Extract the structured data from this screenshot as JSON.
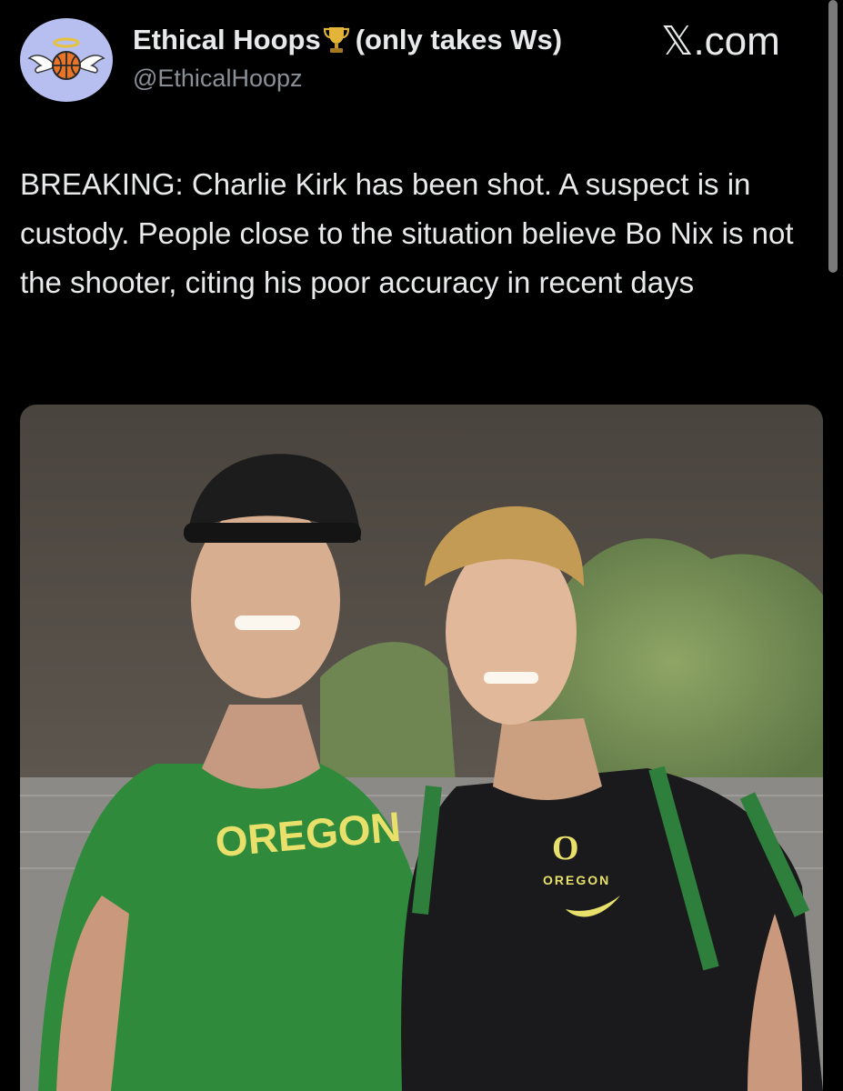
{
  "account": {
    "display_name": "Ethical Hoops",
    "display_suffix": "(only takes Ws)",
    "handle": "@EthicalHoopz",
    "avatar_icon": "angel-basketball-icon",
    "badge_icon": "trophy-icon"
  },
  "brand": {
    "x_glyph": "𝕏",
    "domain": ".com"
  },
  "tweet": {
    "text": "BREAKING: Charlie Kirk has been shot. A suspect is in custody. People close to the situation believe Bo Nix is not the shooter, citing his poor accuracy in recent days"
  },
  "photo": {
    "shirt_left_text": "OREGON",
    "shirt_right_text": "OREGON",
    "shirt_right_logo": "O"
  },
  "colors": {
    "background": "#000000",
    "text": "#e7e9ea",
    "secondary_text": "#8b9097",
    "avatar_bg": "#b7bff0",
    "oregon_green": "#1f8a3a",
    "oregon_yellow": "#e8e06a"
  }
}
